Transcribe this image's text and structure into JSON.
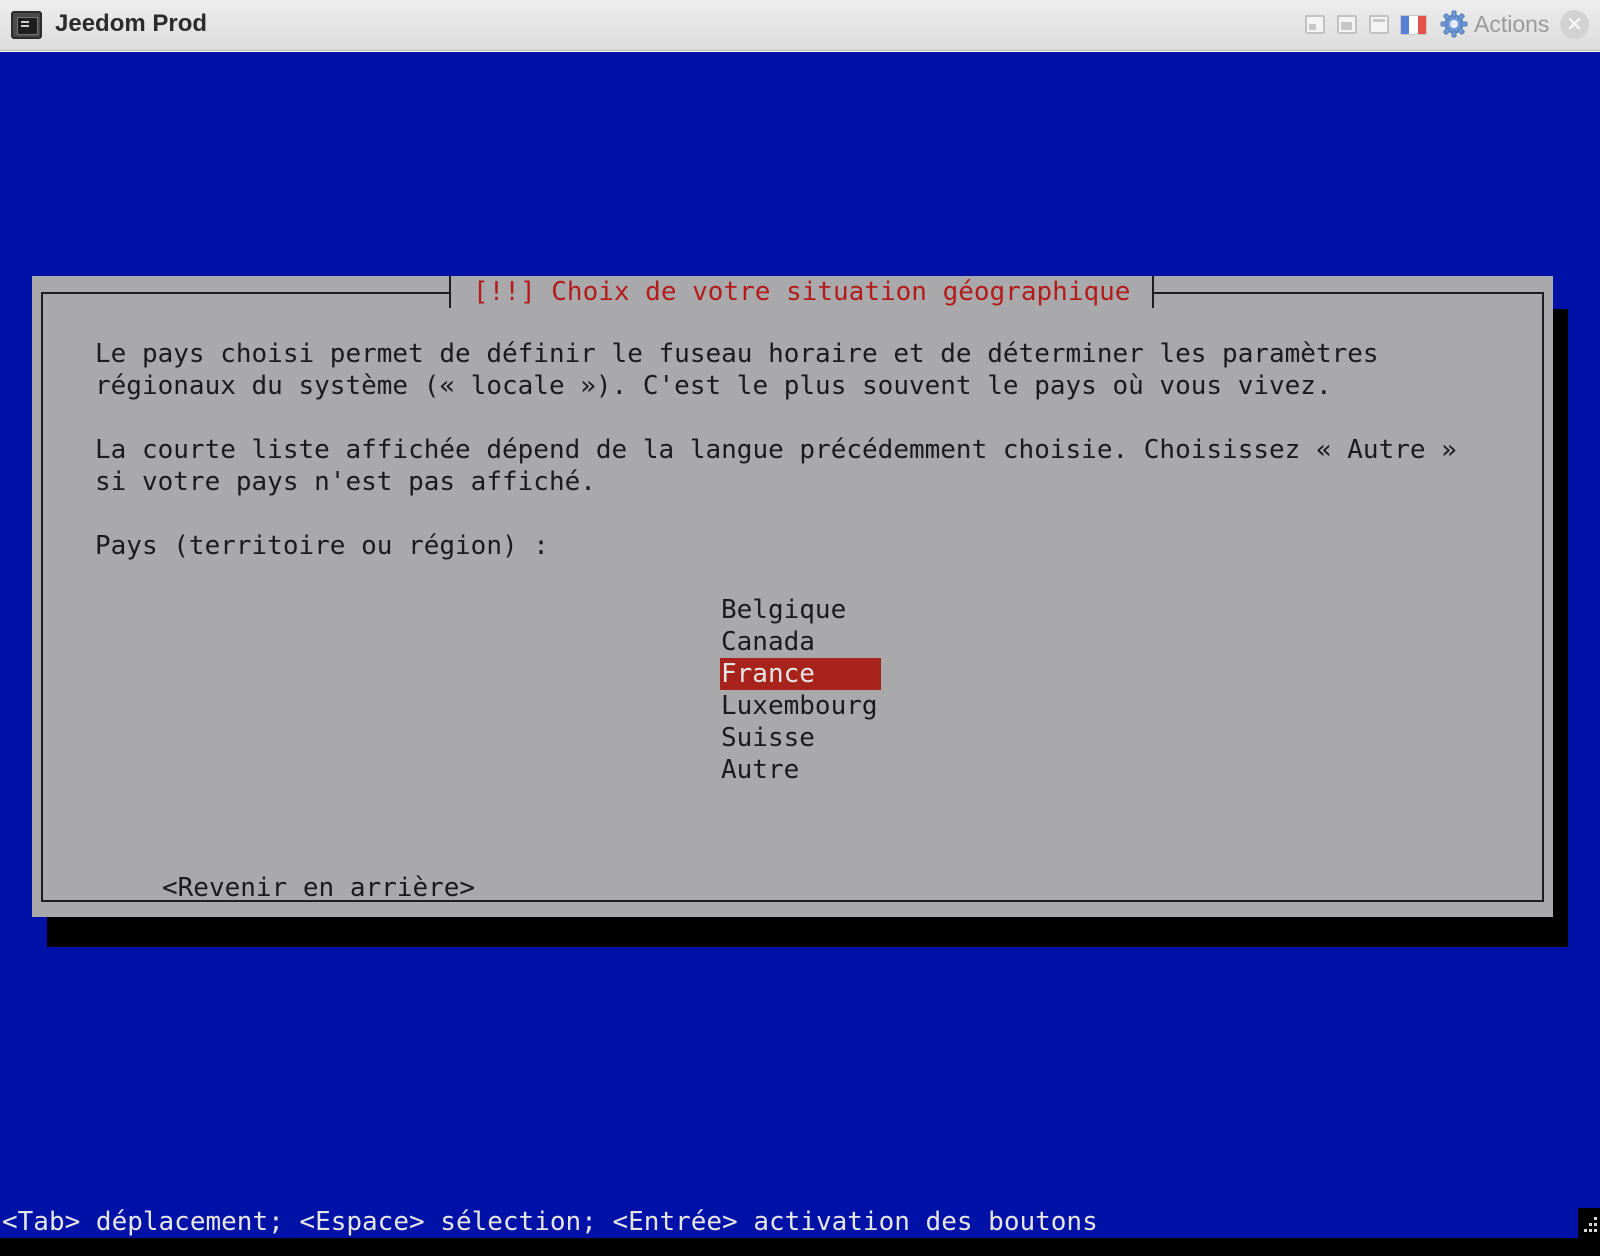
{
  "window": {
    "title": "Jeedom Prod",
    "actions_label": "Actions",
    "icons": [
      "terminal-app-icon",
      "window-size-small-icon",
      "window-size-medium-icon",
      "window-size-large-icon",
      "french-flag-icon",
      "gear-icon",
      "close-icon"
    ]
  },
  "dialog": {
    "title": "[!!] Choix de votre situation géographique",
    "paragraph1_line1": "Le pays choisi permet de définir le fuseau horaire et de déterminer les paramètres",
    "paragraph1_line2": "régionaux du système (« locale »). C'est le plus souvent le pays où vous vivez.",
    "paragraph2_line1": "La courte liste affichée dépend de la langue précédemment choisie. Choisissez « Autre »",
    "paragraph2_line2": "si votre pays n'est pas affiché.",
    "prompt": "Pays (territoire ou région) :",
    "countries": [
      {
        "label": "Belgique",
        "selected": false
      },
      {
        "label": "Canada",
        "selected": false
      },
      {
        "label": "France",
        "selected": true
      },
      {
        "label": "Luxembourg",
        "selected": false
      },
      {
        "label": "Suisse",
        "selected": false
      },
      {
        "label": "Autre",
        "selected": false
      }
    ],
    "back_button": "<Revenir en arrière>"
  },
  "help_bar": "<Tab> déplacement; <Espace> sélection; <Entrée> activation des boutons",
  "colors": {
    "screen_background": "#0011a8",
    "dialog_background": "#a9a9ab",
    "title_text": "#b31b1b",
    "selection_background": "#a8231b"
  }
}
